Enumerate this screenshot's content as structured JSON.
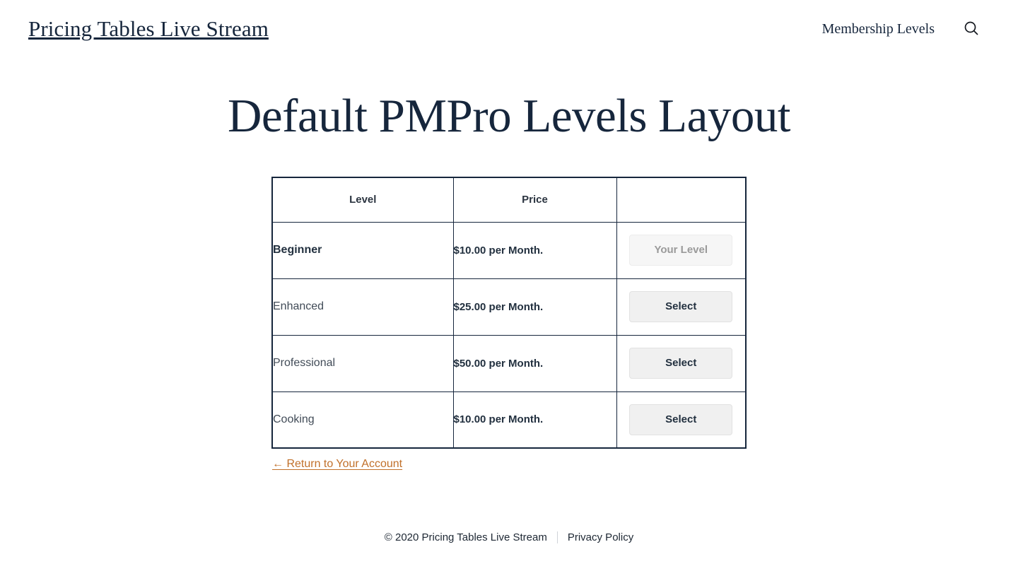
{
  "header": {
    "site_title": "Pricing Tables Live Stream",
    "nav_link": "Membership Levels",
    "search_icon": "search-icon"
  },
  "main": {
    "heading": "Default PMPro Levels Layout",
    "table": {
      "columns": [
        "Level",
        "Price",
        ""
      ],
      "rows": [
        {
          "level": "Beginner",
          "price": "$10.00 per Month.",
          "action": "Your Level",
          "current": true
        },
        {
          "level": "Enhanced",
          "price": "$25.00 per Month.",
          "action": "Select",
          "current": false
        },
        {
          "level": "Professional",
          "price": "$50.00 per Month.",
          "action": "Select",
          "current": false
        },
        {
          "level": "Cooking",
          "price": "$10.00 per Month.",
          "action": "Select",
          "current": false
        }
      ]
    },
    "return_link": "← Return to Your Account"
  },
  "footer": {
    "copyright": "© 2020  Pricing Tables Live Stream",
    "privacy_link": "Privacy Policy"
  },
  "colors": {
    "ink": "#16263c",
    "link_orange": "#c1702a",
    "button_bg": "#f0f0f0",
    "button_disabled_text": "#9a9a9a"
  }
}
